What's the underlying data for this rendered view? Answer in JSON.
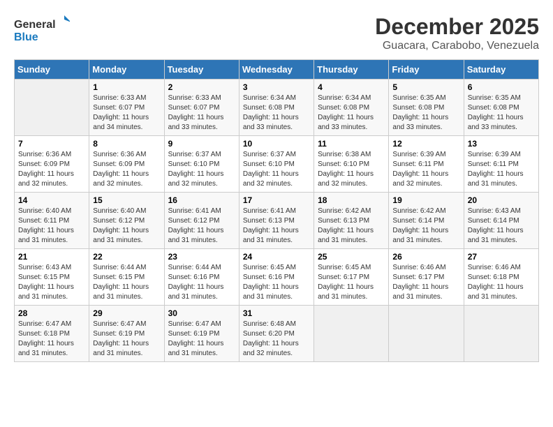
{
  "logo": {
    "line1": "General",
    "line2": "Blue"
  },
  "title": "December 2025",
  "subtitle": "Guacara, Carabobo, Venezuela",
  "days_of_week": [
    "Sunday",
    "Monday",
    "Tuesday",
    "Wednesday",
    "Thursday",
    "Friday",
    "Saturday"
  ],
  "weeks": [
    [
      {
        "day": "",
        "sunrise": "",
        "sunset": "",
        "daylight": ""
      },
      {
        "day": "1",
        "sunrise": "Sunrise: 6:33 AM",
        "sunset": "Sunset: 6:07 PM",
        "daylight": "Daylight: 11 hours and 34 minutes."
      },
      {
        "day": "2",
        "sunrise": "Sunrise: 6:33 AM",
        "sunset": "Sunset: 6:07 PM",
        "daylight": "Daylight: 11 hours and 33 minutes."
      },
      {
        "day": "3",
        "sunrise": "Sunrise: 6:34 AM",
        "sunset": "Sunset: 6:08 PM",
        "daylight": "Daylight: 11 hours and 33 minutes."
      },
      {
        "day": "4",
        "sunrise": "Sunrise: 6:34 AM",
        "sunset": "Sunset: 6:08 PM",
        "daylight": "Daylight: 11 hours and 33 minutes."
      },
      {
        "day": "5",
        "sunrise": "Sunrise: 6:35 AM",
        "sunset": "Sunset: 6:08 PM",
        "daylight": "Daylight: 11 hours and 33 minutes."
      },
      {
        "day": "6",
        "sunrise": "Sunrise: 6:35 AM",
        "sunset": "Sunset: 6:08 PM",
        "daylight": "Daylight: 11 hours and 33 minutes."
      }
    ],
    [
      {
        "day": "7",
        "sunrise": "Sunrise: 6:36 AM",
        "sunset": "Sunset: 6:09 PM",
        "daylight": "Daylight: 11 hours and 32 minutes."
      },
      {
        "day": "8",
        "sunrise": "Sunrise: 6:36 AM",
        "sunset": "Sunset: 6:09 PM",
        "daylight": "Daylight: 11 hours and 32 minutes."
      },
      {
        "day": "9",
        "sunrise": "Sunrise: 6:37 AM",
        "sunset": "Sunset: 6:10 PM",
        "daylight": "Daylight: 11 hours and 32 minutes."
      },
      {
        "day": "10",
        "sunrise": "Sunrise: 6:37 AM",
        "sunset": "Sunset: 6:10 PM",
        "daylight": "Daylight: 11 hours and 32 minutes."
      },
      {
        "day": "11",
        "sunrise": "Sunrise: 6:38 AM",
        "sunset": "Sunset: 6:10 PM",
        "daylight": "Daylight: 11 hours and 32 minutes."
      },
      {
        "day": "12",
        "sunrise": "Sunrise: 6:39 AM",
        "sunset": "Sunset: 6:11 PM",
        "daylight": "Daylight: 11 hours and 32 minutes."
      },
      {
        "day": "13",
        "sunrise": "Sunrise: 6:39 AM",
        "sunset": "Sunset: 6:11 PM",
        "daylight": "Daylight: 11 hours and 31 minutes."
      }
    ],
    [
      {
        "day": "14",
        "sunrise": "Sunrise: 6:40 AM",
        "sunset": "Sunset: 6:11 PM",
        "daylight": "Daylight: 11 hours and 31 minutes."
      },
      {
        "day": "15",
        "sunrise": "Sunrise: 6:40 AM",
        "sunset": "Sunset: 6:12 PM",
        "daylight": "Daylight: 11 hours and 31 minutes."
      },
      {
        "day": "16",
        "sunrise": "Sunrise: 6:41 AM",
        "sunset": "Sunset: 6:12 PM",
        "daylight": "Daylight: 11 hours and 31 minutes."
      },
      {
        "day": "17",
        "sunrise": "Sunrise: 6:41 AM",
        "sunset": "Sunset: 6:13 PM",
        "daylight": "Daylight: 11 hours and 31 minutes."
      },
      {
        "day": "18",
        "sunrise": "Sunrise: 6:42 AM",
        "sunset": "Sunset: 6:13 PM",
        "daylight": "Daylight: 11 hours and 31 minutes."
      },
      {
        "day": "19",
        "sunrise": "Sunrise: 6:42 AM",
        "sunset": "Sunset: 6:14 PM",
        "daylight": "Daylight: 11 hours and 31 minutes."
      },
      {
        "day": "20",
        "sunrise": "Sunrise: 6:43 AM",
        "sunset": "Sunset: 6:14 PM",
        "daylight": "Daylight: 11 hours and 31 minutes."
      }
    ],
    [
      {
        "day": "21",
        "sunrise": "Sunrise: 6:43 AM",
        "sunset": "Sunset: 6:15 PM",
        "daylight": "Daylight: 11 hours and 31 minutes."
      },
      {
        "day": "22",
        "sunrise": "Sunrise: 6:44 AM",
        "sunset": "Sunset: 6:15 PM",
        "daylight": "Daylight: 11 hours and 31 minutes."
      },
      {
        "day": "23",
        "sunrise": "Sunrise: 6:44 AM",
        "sunset": "Sunset: 6:16 PM",
        "daylight": "Daylight: 11 hours and 31 minutes."
      },
      {
        "day": "24",
        "sunrise": "Sunrise: 6:45 AM",
        "sunset": "Sunset: 6:16 PM",
        "daylight": "Daylight: 11 hours and 31 minutes."
      },
      {
        "day": "25",
        "sunrise": "Sunrise: 6:45 AM",
        "sunset": "Sunset: 6:17 PM",
        "daylight": "Daylight: 11 hours and 31 minutes."
      },
      {
        "day": "26",
        "sunrise": "Sunrise: 6:46 AM",
        "sunset": "Sunset: 6:17 PM",
        "daylight": "Daylight: 11 hours and 31 minutes."
      },
      {
        "day": "27",
        "sunrise": "Sunrise: 6:46 AM",
        "sunset": "Sunset: 6:18 PM",
        "daylight": "Daylight: 11 hours and 31 minutes."
      }
    ],
    [
      {
        "day": "28",
        "sunrise": "Sunrise: 6:47 AM",
        "sunset": "Sunset: 6:18 PM",
        "daylight": "Daylight: 11 hours and 31 minutes."
      },
      {
        "day": "29",
        "sunrise": "Sunrise: 6:47 AM",
        "sunset": "Sunset: 6:19 PM",
        "daylight": "Daylight: 11 hours and 31 minutes."
      },
      {
        "day": "30",
        "sunrise": "Sunrise: 6:47 AM",
        "sunset": "Sunset: 6:19 PM",
        "daylight": "Daylight: 11 hours and 31 minutes."
      },
      {
        "day": "31",
        "sunrise": "Sunrise: 6:48 AM",
        "sunset": "Sunset: 6:20 PM",
        "daylight": "Daylight: 11 hours and 32 minutes."
      },
      {
        "day": "",
        "sunrise": "",
        "sunset": "",
        "daylight": ""
      },
      {
        "day": "",
        "sunrise": "",
        "sunset": "",
        "daylight": ""
      },
      {
        "day": "",
        "sunrise": "",
        "sunset": "",
        "daylight": ""
      }
    ]
  ]
}
